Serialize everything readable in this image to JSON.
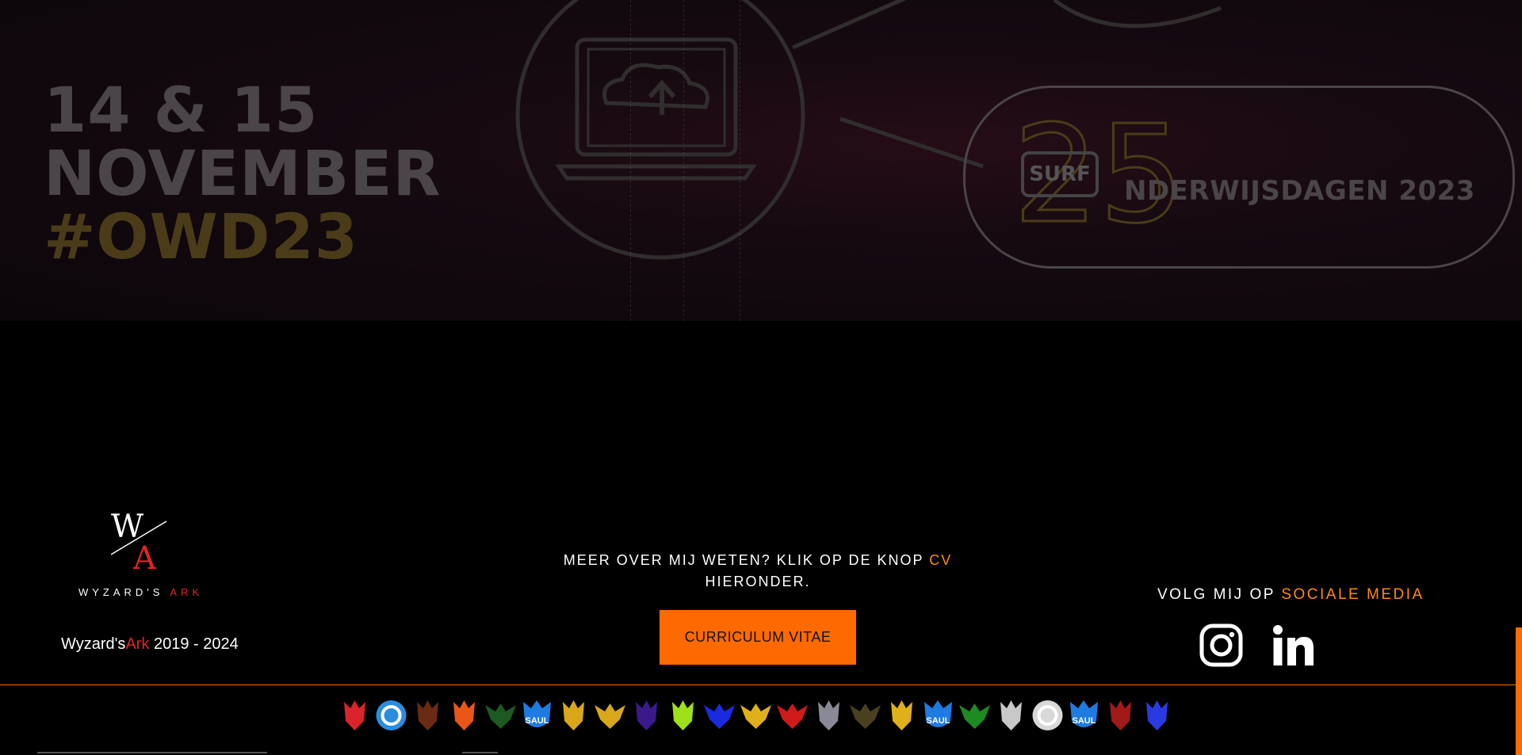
{
  "hero": {
    "dates_line1": "14 & 15",
    "dates_line2": "NOVEMBER",
    "hashtag": "#OWD23",
    "badge_text": "SURF",
    "anniversary_number": "25",
    "event_name": "NDERWIJSDAGEN 2023"
  },
  "footer": {
    "logo": {
      "monogram_top": "W",
      "monogram_bottom": "A",
      "wordmark_white": "WYZARD'S",
      "wordmark_red": "ARK"
    },
    "copyright": {
      "name_white": "Wyzard's",
      "name_red": "Ark",
      "years": " 2019 - 2024"
    },
    "cta": {
      "text_before": "MEER OVER MIJ WETEN? KLIK OP DE KNOP ",
      "text_highlight": "CV",
      "text_after": " HIERONDER.",
      "button_label": "CURRICULUM VITAE"
    },
    "social": {
      "text": "VOLG MIJ OP ",
      "text_highlight": "SOCIALE MEDIA",
      "icons": [
        "instagram-icon",
        "linkedin-icon"
      ]
    }
  },
  "crests": [
    {
      "icon": "red-crest-icon",
      "color": "#d8242a"
    },
    {
      "icon": "blue-g-emblem-icon",
      "color": "#2a8de0"
    },
    {
      "icon": "brown-crest-icon",
      "color": "#6b2a14"
    },
    {
      "icon": "orange-crest-icon",
      "color": "#e8561a"
    },
    {
      "icon": "green-wings-icon",
      "color": "#1d5a22"
    },
    {
      "icon": "blue-saul-badge-icon",
      "color": "#1e7be0",
      "label": "SAUL"
    },
    {
      "icon": "gold-small-crest-icon",
      "color": "#d8a81a"
    },
    {
      "icon": "gold-wings-icon",
      "color": "#d8a81a"
    },
    {
      "icon": "purple-crest-icon",
      "color": "#3a1a8a"
    },
    {
      "icon": "lime-crest-icon",
      "color": "#9ee01a"
    },
    {
      "icon": "blue-wings-icon",
      "color": "#1a2ae0"
    },
    {
      "icon": "gold-wings-icon",
      "color": "#e0b01a"
    },
    {
      "icon": "red-wings-icon",
      "color": "#d01a1a"
    },
    {
      "icon": "grey-crest-icon",
      "color": "#8a8a96"
    },
    {
      "icon": "olive-wings-icon",
      "color": "#4a4020"
    },
    {
      "icon": "gold-crest-icon",
      "color": "#e0b01a"
    },
    {
      "icon": "blue-saul-badge-icon",
      "color": "#1e7be0",
      "label": "SAUL"
    },
    {
      "icon": "green-dragon-icon",
      "color": "#1d8a22"
    },
    {
      "icon": "silver-beast-icon",
      "color": "#c8c8c8"
    },
    {
      "icon": "white-star-emblem-icon",
      "color": "#d8d8d8"
    },
    {
      "icon": "blue-saul-badge-icon",
      "color": "#1e7be0",
      "label": "SAUL"
    },
    {
      "icon": "dark-red-crest-icon",
      "color": "#a01a1a"
    },
    {
      "icon": "blue-red-crest-icon",
      "color": "#2a3ae0"
    }
  ]
}
